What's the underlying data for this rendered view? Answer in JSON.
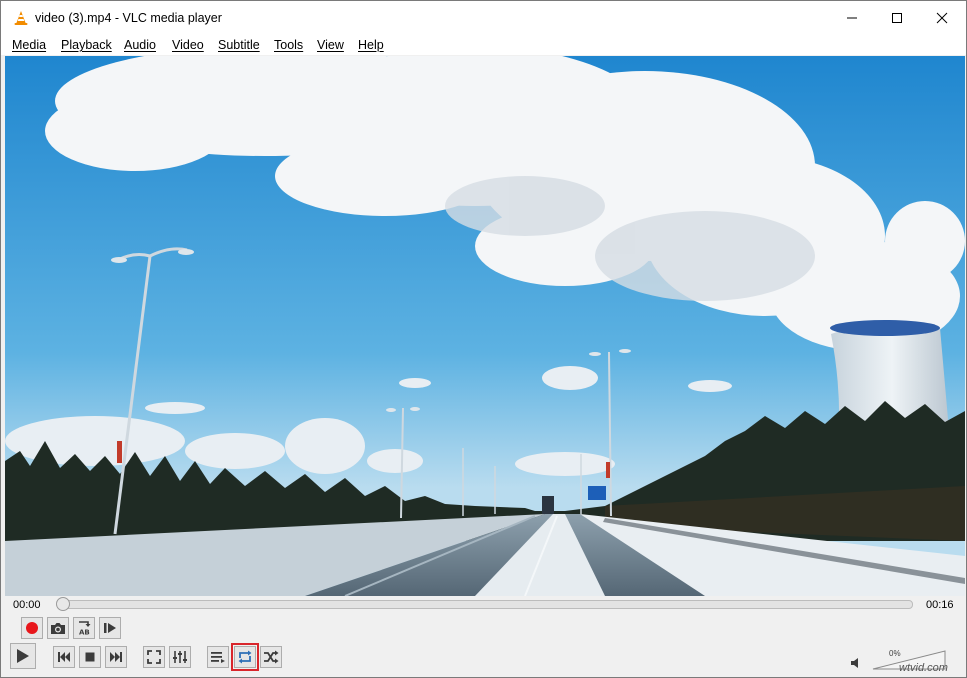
{
  "window": {
    "title": "video (3).mp4 - VLC media player",
    "icon": "vlc-cone-icon",
    "controls": [
      "minimize-icon",
      "maximize-icon",
      "close-icon"
    ]
  },
  "menu": {
    "items": [
      {
        "label": "Media"
      },
      {
        "label": "Playback"
      },
      {
        "label": "Audio"
      },
      {
        "label": "Video"
      },
      {
        "label": "Subtitle"
      },
      {
        "label": "Tools"
      },
      {
        "label": "View"
      },
      {
        "label": "Help"
      }
    ]
  },
  "playback": {
    "elapsed": "00:00",
    "total": "00:16",
    "progress": 0.0
  },
  "controls": {
    "row1": [
      "record-icon",
      "snapshot-icon",
      "loop-ab-icon",
      "frame-step-icon"
    ],
    "row2": [
      "play-icon",
      "previous-icon",
      "stop-icon",
      "next-icon",
      "fullscreen-icon",
      "extended-settings-icon",
      "playlist-icon",
      "loop-icon",
      "shuffle-icon"
    ],
    "highlighted": "loop-icon"
  },
  "volume": {
    "percent_label": "0%",
    "level": 0.0
  },
  "watermark": "wtvid.com",
  "colors": {
    "record": "#e8161b",
    "highlight": "#d9262c",
    "sky": "#4da6db",
    "snow": "#e7eef3"
  }
}
